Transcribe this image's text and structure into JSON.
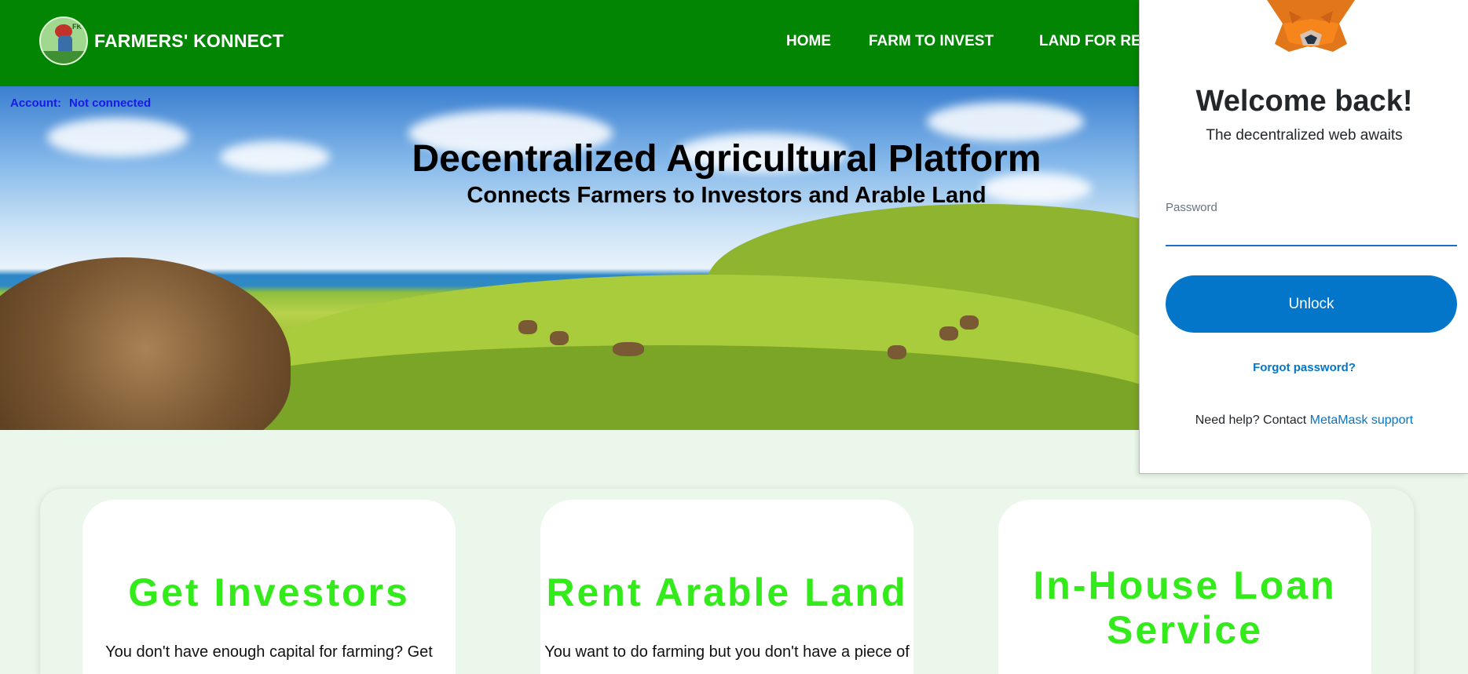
{
  "header": {
    "brand": "FARMERS' KONNECT",
    "logo_text": "FK",
    "nav": [
      "HOME",
      "FARM TO INVEST",
      "LAND FOR RE"
    ],
    "bg_color": "#028502"
  },
  "account": {
    "label": "Account:",
    "status": "Not connected"
  },
  "hero": {
    "title": "Decentralized Agricultural Platform",
    "subtitle": "Connects Farmers to Investors and Arable Land"
  },
  "cards": [
    {
      "title": "Get Investors",
      "text": "You don't have enough capital for farming? Get"
    },
    {
      "title": "Rent Arable Land",
      "text": "You want to do farming but you don't have a piece of"
    },
    {
      "title": "In-House Loan Service",
      "text": ""
    }
  ],
  "metamask": {
    "icon": "fox-icon",
    "title": "Welcome back!",
    "subtitle": "The decentralized web awaits",
    "password_label": "Password",
    "password_value": "",
    "unlock_label": "Unlock",
    "forgot_label": "Forgot password?",
    "help_text": "Need help? Contact",
    "help_link": "MetaMask support",
    "accent_color": "#0376c9"
  }
}
